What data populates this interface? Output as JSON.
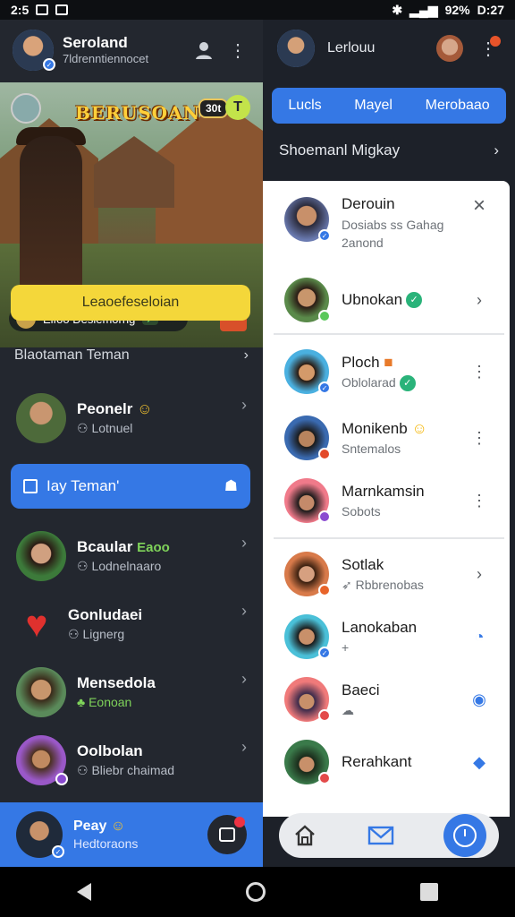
{
  "status_bar": {
    "left_time": "2:5",
    "right_time": "D:27",
    "battery": "92%"
  },
  "left_panel": {
    "header": {
      "title": "Seroland",
      "subtitle": "7ldrenntiennocet"
    },
    "banner": {
      "title": "BERUSOAN",
      "tag": "30t",
      "strip_text": "Elfoo Desiemorng"
    },
    "primary_button": "Leaoefeseloian",
    "section_title": "Blaotaman Teman",
    "friends_top": {
      "name": "Peonelr",
      "sub": "Lotnuel"
    },
    "action_bar": "Iay Teman'",
    "friends": [
      {
        "name": "Bcaular",
        "tag": "Eaoo",
        "sub": "Lodnelnaaro"
      },
      {
        "name": "Gonludaei",
        "sub": "Lignerg"
      },
      {
        "name": "Mensedola",
        "sub": "Eonoan"
      },
      {
        "name": "Oolbolan",
        "sub": "Bliebr chaimad"
      }
    ],
    "footer": {
      "name": "Peay",
      "sub": "Hedtoraons"
    }
  },
  "right_panel": {
    "header": {
      "label": "Lerlouu"
    },
    "tabs": [
      "Lucls",
      "Mayel",
      "Merobaao"
    ],
    "section_title": "Shoemanl Migkay",
    "contacts": [
      {
        "name": "Derouin",
        "sub": "Dosiabs ss Gahag",
        "sub2": "2anond"
      },
      {
        "name": "Ubnokan",
        "sub": ""
      },
      {
        "name": "Ploch",
        "sub": "Oblolarad"
      },
      {
        "name": "Monikenb",
        "sub": "Sntemalos"
      },
      {
        "name": "Marnkamsin",
        "sub": "Sobots"
      },
      {
        "name": "Sotlak",
        "sub": "Rbbrenobas"
      },
      {
        "name": "Lanokaban",
        "sub": "+"
      },
      {
        "name": "Baeci",
        "sub": ""
      },
      {
        "name": "Rerahkant",
        "sub": ""
      }
    ]
  },
  "colors": {
    "accent": "#3578e5",
    "yellow": "#f4d73a",
    "dark": "#23272f"
  }
}
